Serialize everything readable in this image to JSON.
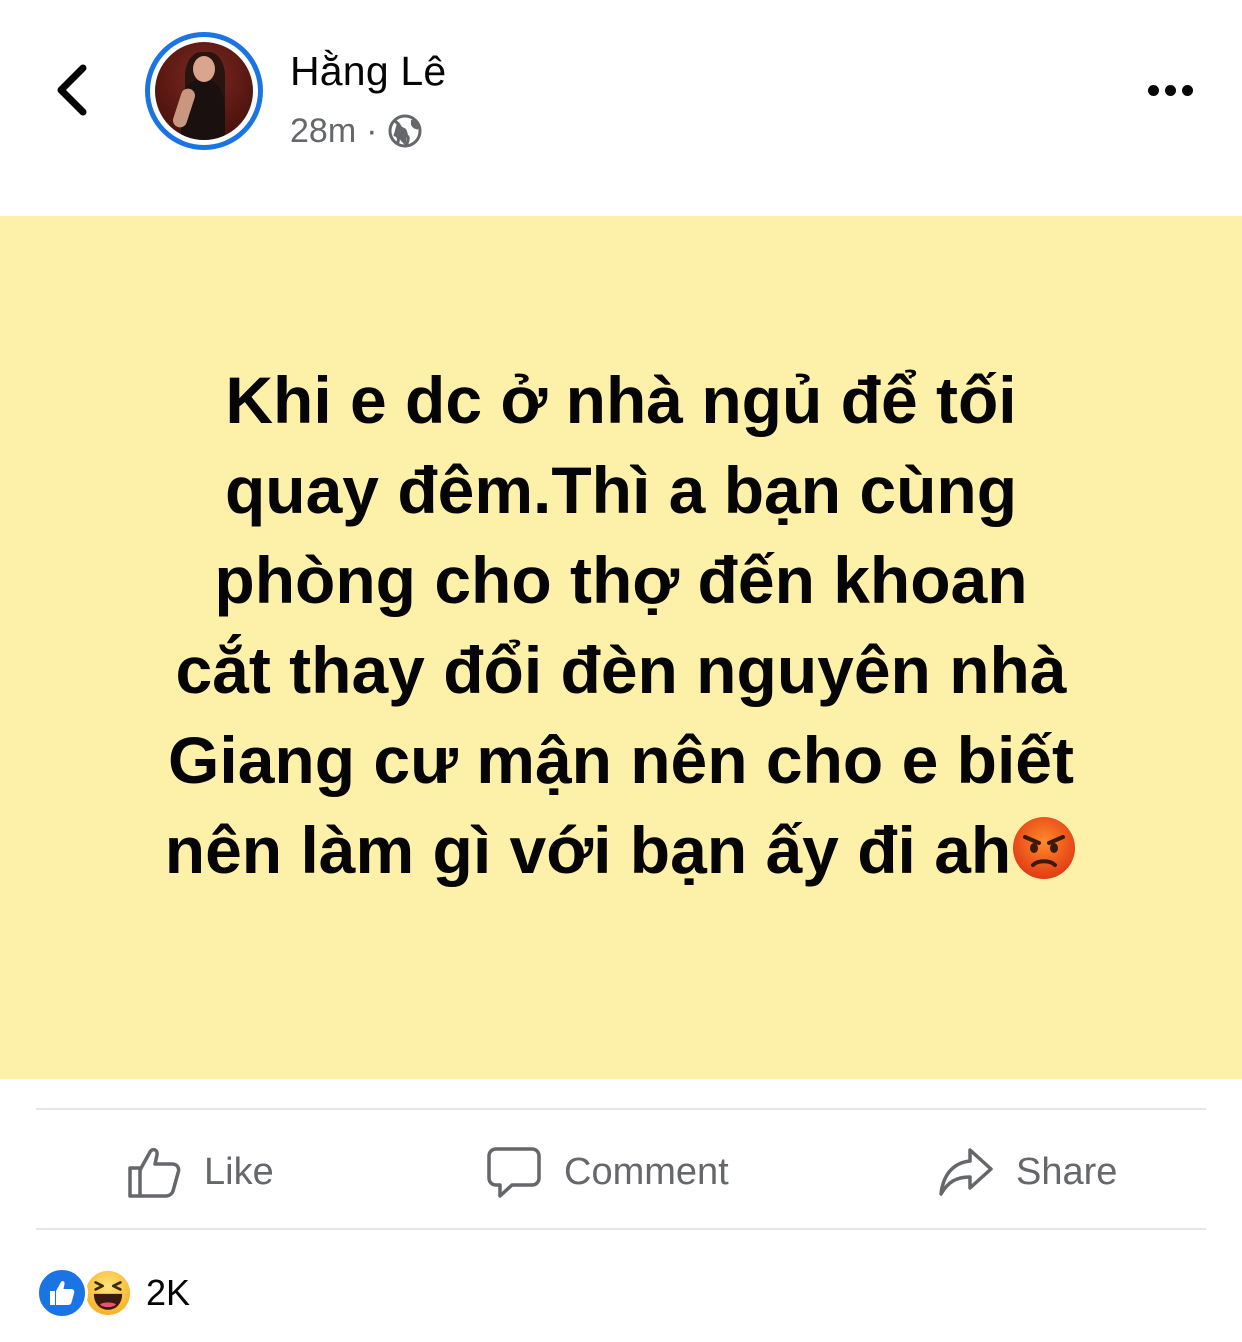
{
  "header": {
    "user_name": "Hằng Lê",
    "time": "28m",
    "separator": "·",
    "privacy_icon": "globe-icon",
    "back_icon": "chevron-left-icon",
    "more_icon": "more-horizontal-icon",
    "avatar_ring_color": "#1b74e4"
  },
  "post": {
    "background_color": "#fdf1aa",
    "lines": [
      "Khi e dc ở nhà ngủ để tối",
      "quay đêm.Thì a bạn cùng",
      "phòng cho thợ đến khoan",
      "cắt thay đổi đèn nguyên nhà",
      "Giang cư mận nên cho e biết",
      "nên làm gì với bạn ấy đi ah"
    ],
    "trailing_emoji": "angry-face-emoji"
  },
  "actions": {
    "like_label": "Like",
    "comment_label": "Comment",
    "share_label": "Share"
  },
  "reactions": {
    "types": [
      "like",
      "haha"
    ],
    "count": "2K"
  },
  "colors": {
    "secondary_text": "#65676b",
    "primary_text": "#050505",
    "brand_blue": "#1b74e4",
    "divider": "#e4e6eb"
  }
}
